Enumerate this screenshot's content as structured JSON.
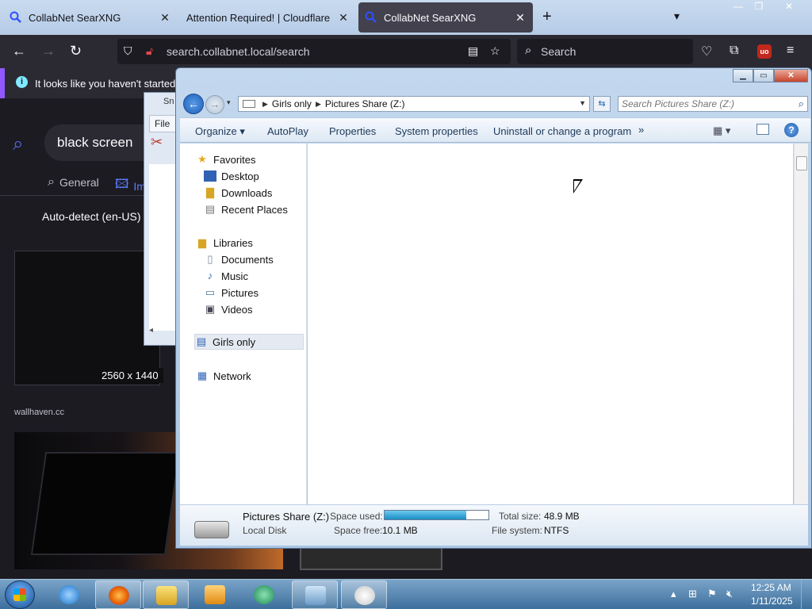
{
  "browser": {
    "tabs": [
      {
        "title": "CollabNet SearXNG",
        "active": false
      },
      {
        "title": "Attention Required! | Cloudflare",
        "active": false
      },
      {
        "title": "CollabNet SearXNG",
        "active": true
      }
    ],
    "url": "search.collabnet.local/search",
    "search_placeholder": "Search",
    "ublock_label": "uo"
  },
  "page": {
    "notice_text": "It looks like you haven't started Fi",
    "query": "black screen",
    "categories": [
      {
        "label": "General",
        "icon": "search-icon"
      },
      {
        "label": "Im",
        "icon": "image-icon"
      }
    ],
    "locale": "Auto-detect (en-US)",
    "results": [
      {
        "resolution": "2560 x 1440",
        "source": "wallhaven.cc"
      }
    ]
  },
  "snipping_tool": {
    "title": "Sn",
    "menu_file": "File"
  },
  "explorer": {
    "breadcrumb": [
      "Girls only",
      "Pictures Share (Z:)"
    ],
    "search_placeholder": "Search Pictures Share (Z:)",
    "commands": [
      "Organize",
      "AutoPlay",
      "Properties",
      "System properties",
      "Uninstall or change a program"
    ],
    "more": "»",
    "nav": {
      "favorites": {
        "label": "Favorites",
        "items": [
          "Desktop",
          "Downloads",
          "Recent Places"
        ]
      },
      "libraries": {
        "label": "Libraries",
        "items": [
          "Documents",
          "Music",
          "Pictures",
          "Videos"
        ]
      },
      "computer": {
        "label": "Girls only"
      },
      "network": {
        "label": "Network"
      }
    },
    "details": {
      "drive_name": "Pictures Share (Z:)",
      "drive_type": "Local Disk",
      "space_used_label": "Space used:",
      "space_used_fraction": 0.79,
      "space_free_label": "Space free:",
      "space_free": "10.1 MB",
      "total_size_label": "Total size:",
      "total_size": "48.9 MB",
      "file_system_label": "File system:",
      "file_system": "NTFS"
    }
  },
  "taskbar": {
    "time": "12:25 AM",
    "date": "1/11/2025"
  },
  "colors": {
    "firefox_tabbar": "#c9dbef",
    "firefox_toolbar": "#2b2a33",
    "page_bg": "#1c1b22",
    "explorer_frame": "#c3d8ee",
    "usage_fill": "#1a8ec4",
    "taskbar": "#3d6f9c"
  }
}
